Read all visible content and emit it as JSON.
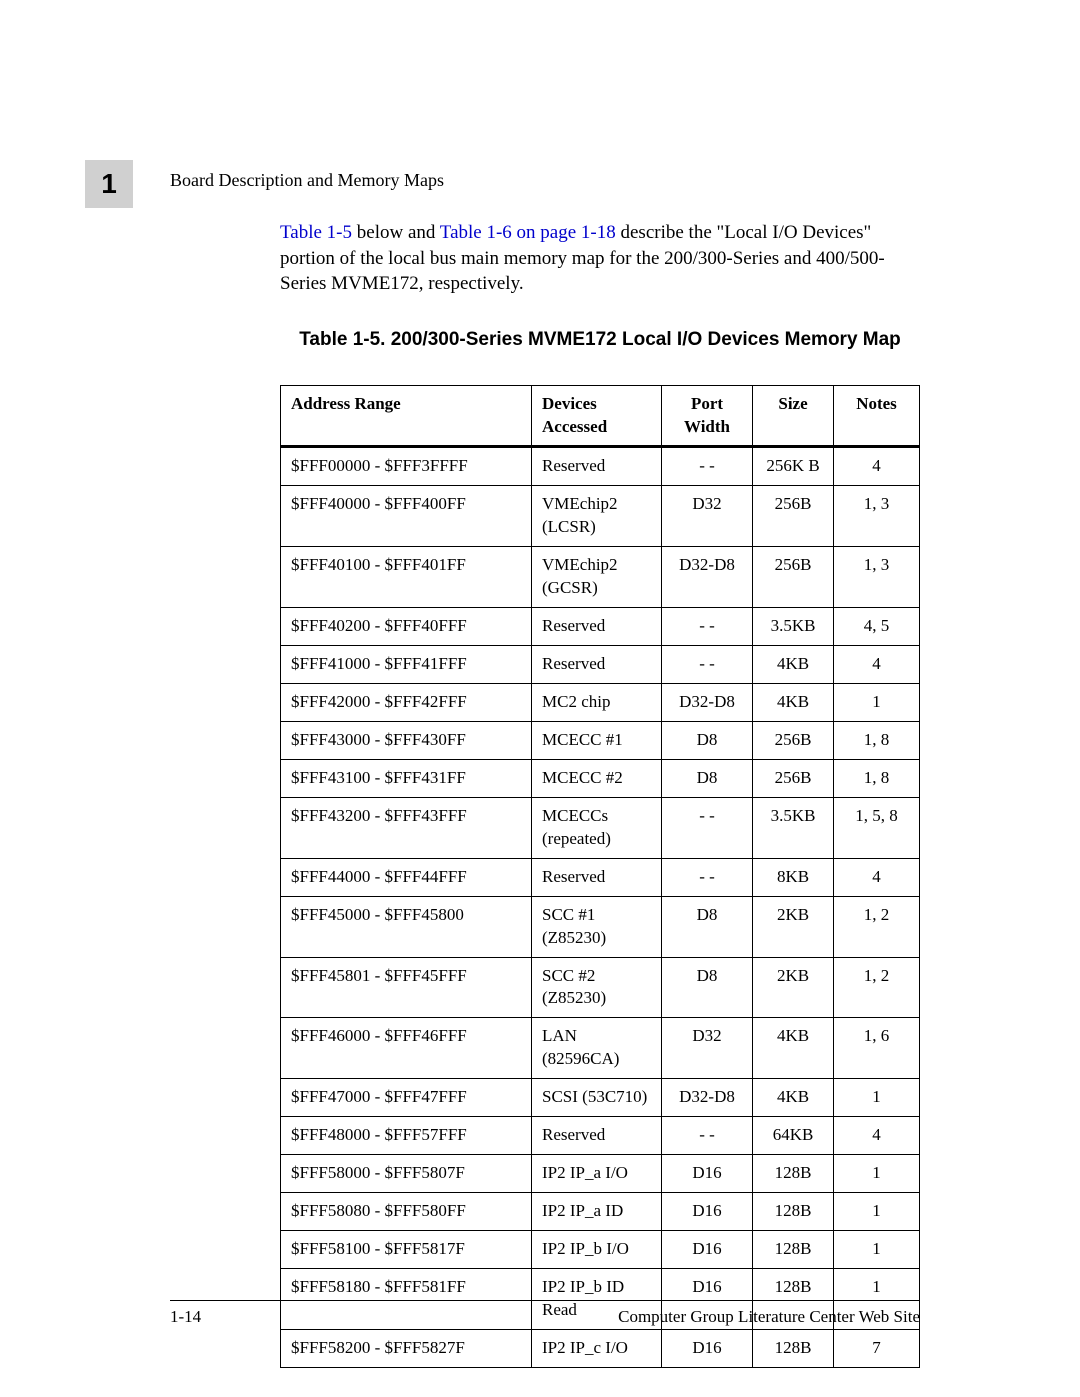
{
  "chapter_number": "1",
  "running_head": "Board Description and Memory Maps",
  "paragraph": {
    "link1": "Table 1-5",
    "mid1": " below and ",
    "link2": "Table 1-6 on page 1-18",
    "rest": " describe the \"Local I/O Devices\" portion of the local bus main memory map for the 200/300-Series and 400/500-Series MVME172, respectively."
  },
  "table_caption": "Table 1-5.  200/300-Series MVME172 Local I/O Devices Memory Map",
  "headers": {
    "addr": "Address Range",
    "dev": "Devices Accessed",
    "port": "Port Width",
    "size": "Size",
    "notes": "Notes"
  },
  "rows": [
    {
      "addr": "$FFF00000 - $FFF3FFFF",
      "dev": "Reserved",
      "port": "- -",
      "size": "256K B",
      "notes": "4"
    },
    {
      "addr": "$FFF40000 - $FFF400FF",
      "dev": "VMEchip2 (LCSR)",
      "port": "D32",
      "size": "256B",
      "notes": "1, 3"
    },
    {
      "addr": "$FFF40100 - $FFF401FF",
      "dev": "VMEchip2 (GCSR)",
      "port": "D32-D8",
      "size": "256B",
      "notes": "1, 3"
    },
    {
      "addr": "$FFF40200 - $FFF40FFF",
      "dev": "Reserved",
      "port": "- -",
      "size": "3.5KB",
      "notes": "4, 5"
    },
    {
      "addr": "$FFF41000 - $FFF41FFF",
      "dev": "Reserved",
      "port": "- -",
      "size": "4KB",
      "notes": "4"
    },
    {
      "addr": "$FFF42000 - $FFF42FFF",
      "dev": "MC2 chip",
      "port": "D32-D8",
      "size": "4KB",
      "notes": "1"
    },
    {
      "addr": "$FFF43000 - $FFF430FF",
      "dev": "MCECC #1",
      "port": "D8",
      "size": "256B",
      "notes": "1, 8"
    },
    {
      "addr": "$FFF43100 - $FFF431FF",
      "dev": "MCECC #2",
      "port": "D8",
      "size": "256B",
      "notes": "1, 8"
    },
    {
      "addr": "$FFF43200 - $FFF43FFF",
      "dev": "MCECCs (repeated)",
      "port": "- -",
      "size": "3.5KB",
      "notes": "1, 5, 8"
    },
    {
      "addr": "$FFF44000 - $FFF44FFF",
      "dev": "Reserved",
      "port": "- -",
      "size": "8KB",
      "notes": "4"
    },
    {
      "addr": "$FFF45000 - $FFF45800",
      "dev": "SCC #1 (Z85230)",
      "port": "D8",
      "size": "2KB",
      "notes": "1, 2"
    },
    {
      "addr": "$FFF45801 - $FFF45FFF",
      "dev": "SCC #2 (Z85230)",
      "port": "D8",
      "size": "2KB",
      "notes": "1, 2"
    },
    {
      "addr": "$FFF46000 - $FFF46FFF",
      "dev": "LAN (82596CA)",
      "port": "D32",
      "size": "4KB",
      "notes": "1, 6"
    },
    {
      "addr": "$FFF47000 - $FFF47FFF",
      "dev": "SCSI (53C710)",
      "port": "D32-D8",
      "size": "4KB",
      "notes": "1"
    },
    {
      "addr": "$FFF48000 - $FFF57FFF",
      "dev": "Reserved",
      "port": "- -",
      "size": "64KB",
      "notes": "4"
    },
    {
      "addr": "$FFF58000 - $FFF5807F",
      "dev": "IP2 IP_a I/O",
      "port": "D16",
      "size": "128B",
      "notes": "1"
    },
    {
      "addr": "$FFF58080 - $FFF580FF",
      "dev": "IP2 IP_a ID",
      "port": "D16",
      "size": "128B",
      "notes": "1"
    },
    {
      "addr": "$FFF58100 - $FFF5817F",
      "dev": "IP2 IP_b I/O",
      "port": "D16",
      "size": "128B",
      "notes": "1"
    },
    {
      "addr": "$FFF58180 - $FFF581FF",
      "dev": "IP2 IP_b ID Read",
      "port": "D16",
      "size": "128B",
      "notes": "1"
    },
    {
      "addr": "$FFF58200 - $FFF5827F",
      "dev": "IP2 IP_c I/O",
      "port": "D16",
      "size": "128B",
      "notes": "7"
    }
  ],
  "footer": {
    "left": "1-14",
    "right": "Computer Group Literature Center Web Site"
  }
}
